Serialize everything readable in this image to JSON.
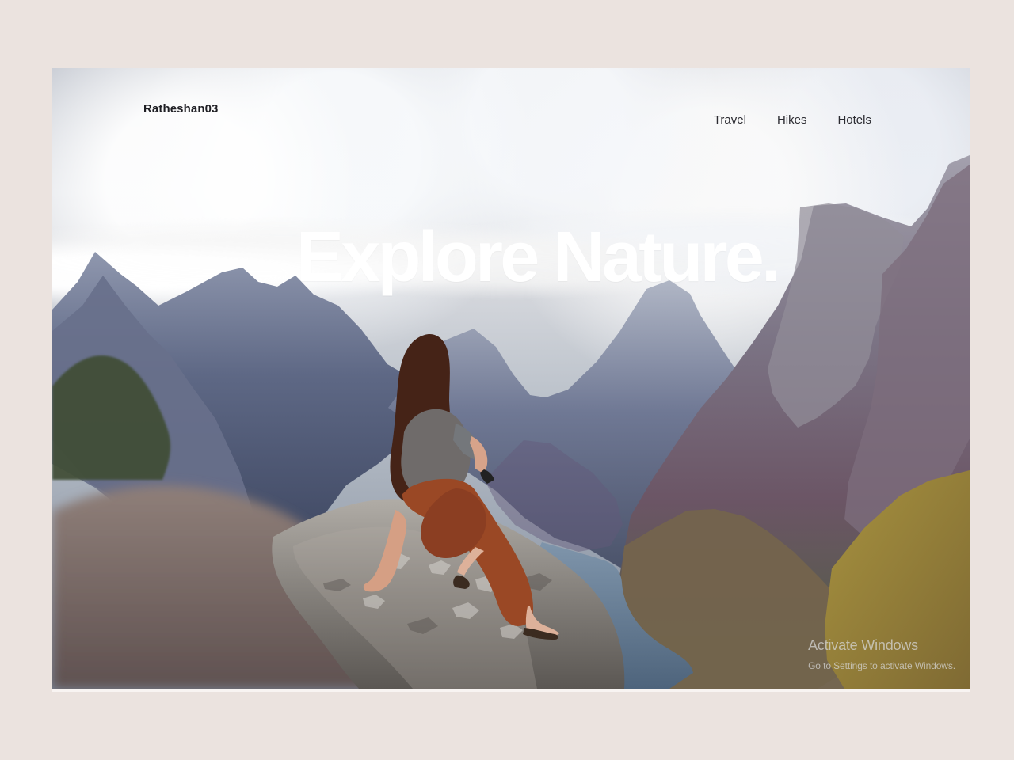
{
  "page": {
    "background_color": "#ebe3df"
  },
  "hero": {
    "brand_label": "Ratheshan03",
    "title": "Explore Nature.",
    "nav": [
      {
        "label": "Travel"
      },
      {
        "label": "Hikes"
      },
      {
        "label": "Hotels"
      }
    ],
    "background_image": {
      "icon_name": "mountain-landscape-photo",
      "accent_colors": {
        "sky": "#d8dce2",
        "mountains": "#5d6882",
        "rock": "#8a8178",
        "river": "#5d7087",
        "grass": "#8a7b39",
        "pants": "#9b4a25"
      }
    }
  },
  "overlay": {
    "watermark_title": "Activate Windows",
    "watermark_subtitle": "Go to Settings to activate Windows."
  }
}
